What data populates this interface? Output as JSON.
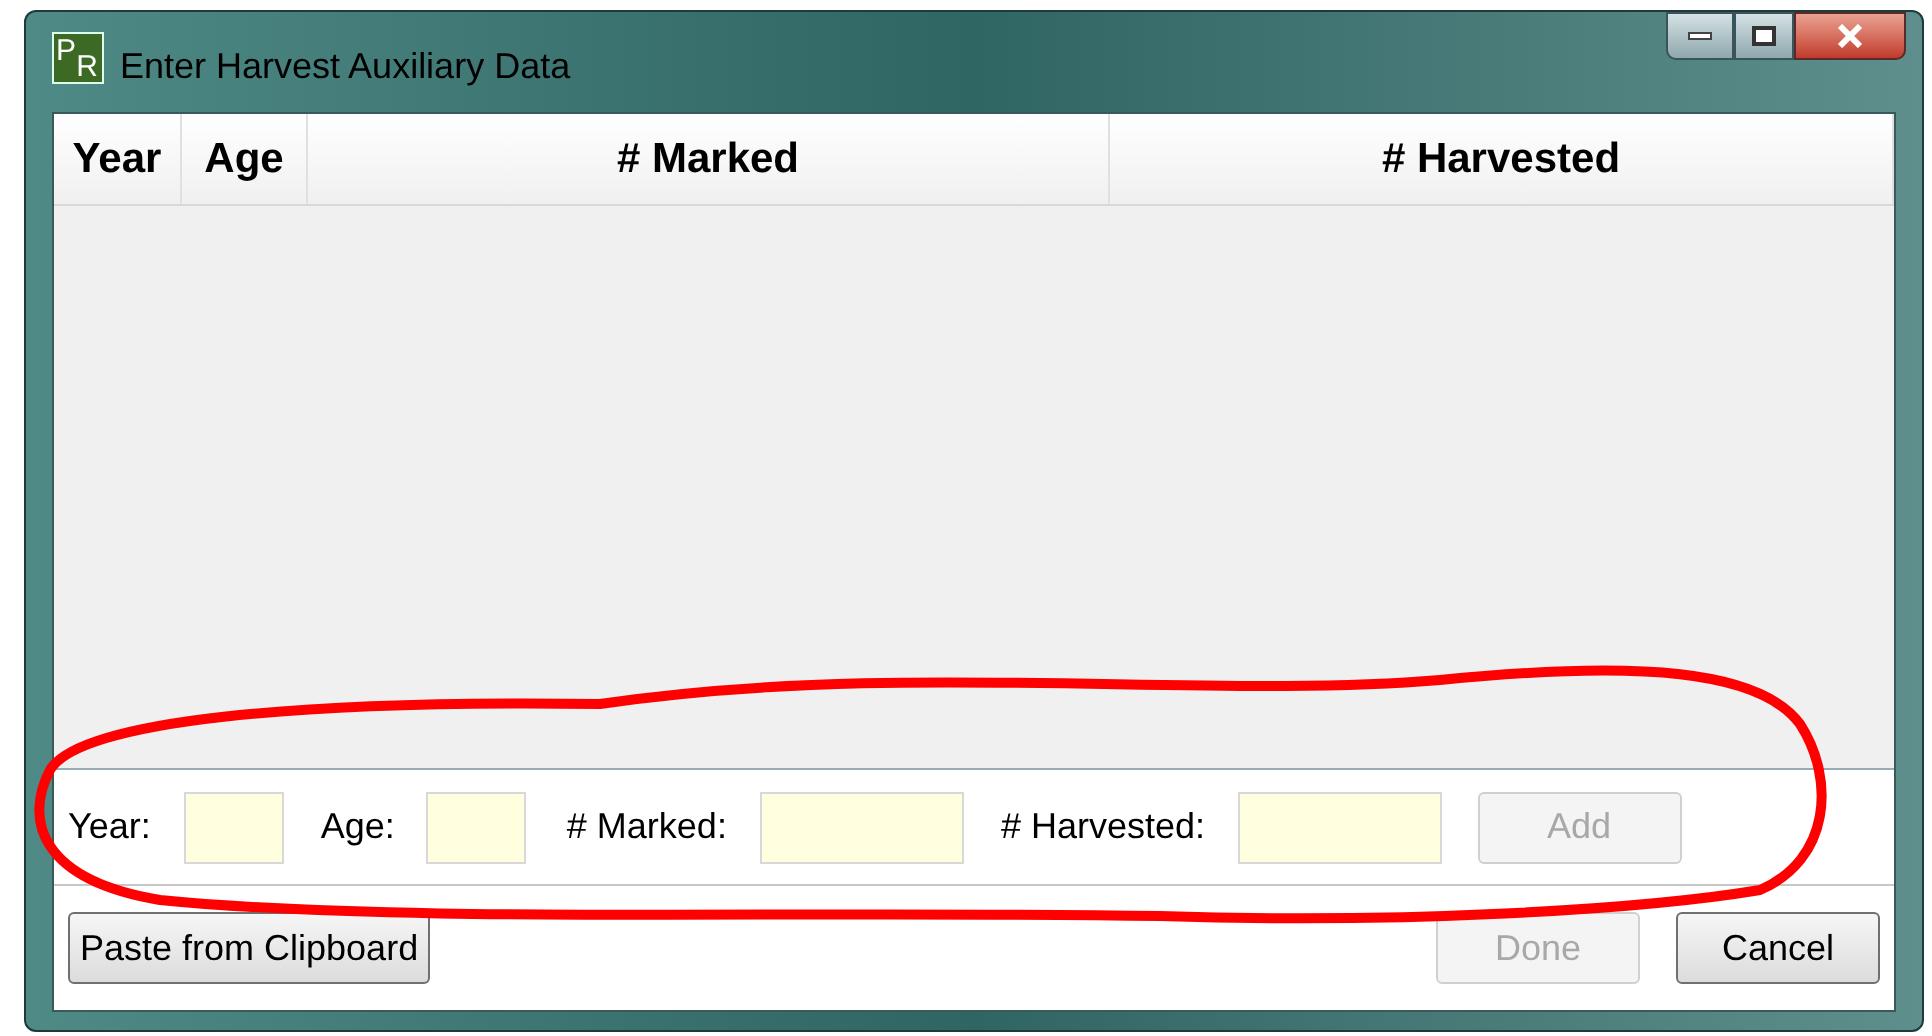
{
  "window": {
    "title": "Enter Harvest Auxiliary Data",
    "logo": {
      "top": "P",
      "bottom": "R"
    }
  },
  "table": {
    "columns": [
      "Year",
      "Age",
      "# Marked",
      "# Harvested"
    ]
  },
  "entry_form": {
    "fields": [
      {
        "label": "Year:"
      },
      {
        "label": "Age:"
      },
      {
        "label": "# Marked:"
      },
      {
        "label": "# Harvested:"
      }
    ],
    "add_button": {
      "label": "Add",
      "disabled": true
    }
  },
  "buttons": [
    {
      "label": "Paste from Clipboard",
      "disabled": false,
      "kind": "left"
    },
    {
      "label": "Done",
      "disabled": true,
      "kind": "right"
    },
    {
      "label": "Cancel",
      "disabled": false,
      "kind": "right"
    }
  ]
}
